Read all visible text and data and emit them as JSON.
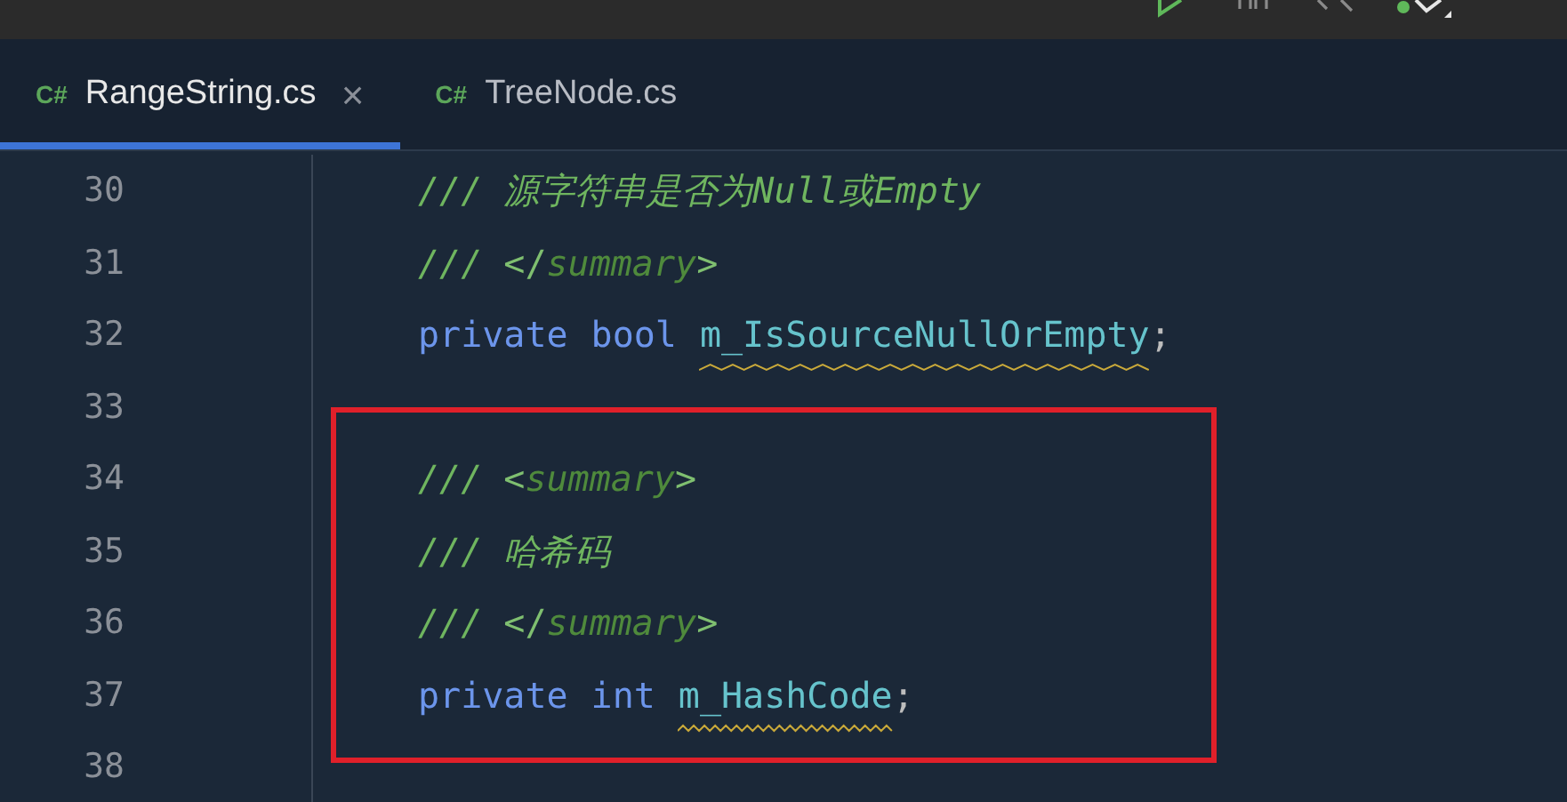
{
  "tabs": [
    {
      "badge": "C#",
      "label": "RangeString.cs",
      "close": "×",
      "selected": true
    },
    {
      "badge": "C#",
      "label": "TreeNode.cs",
      "selected": false
    }
  ],
  "code": {
    "line_numbers": [
      "30",
      "31",
      "32",
      "33",
      "34",
      "35",
      "36",
      "37",
      "38"
    ],
    "blocks": [
      {
        "kind": "plain",
        "lines": [
          {
            "tokens": [
              {
                "text": "/// 源字符串是否为Null或Empty",
                "kind": "comment"
              }
            ]
          },
          {
            "tokens": [
              {
                "text": "/// ",
                "kind": "comment"
              },
              {
                "text": "</",
                "kind": "tag-bracket"
              },
              {
                "text": "summary",
                "kind": "tag-name"
              },
              {
                "text": ">",
                "kind": "tag-bracket"
              }
            ]
          },
          {
            "tokens": [
              {
                "text": "private",
                "kind": "keyword"
              },
              {
                "text": "bool",
                "kind": "keyword"
              },
              {
                "text": "m_IsSourceNullOrEmpty",
                "kind": "field",
                "squiggle": true
              },
              {
                "text": ";",
                "kind": "punct"
              }
            ]
          }
        ]
      },
      {
        "kind": "blank"
      },
      {
        "kind": "highlight",
        "lines": [
          {
            "tokens": [
              {
                "text": "/// ",
                "kind": "comment"
              },
              {
                "text": "<",
                "kind": "tag-bracket"
              },
              {
                "text": "summary",
                "kind": "tag-name"
              },
              {
                "text": ">",
                "kind": "tag-bracket"
              }
            ]
          },
          {
            "tokens": [
              {
                "text": "/// 哈希码",
                "kind": "comment"
              }
            ]
          },
          {
            "tokens": [
              {
                "text": "/// ",
                "kind": "comment"
              },
              {
                "text": "</",
                "kind": "tag-bracket"
              },
              {
                "text": "summary",
                "kind": "tag-name"
              },
              {
                "text": ">",
                "kind": "tag-bracket"
              }
            ]
          },
          {
            "tokens": [
              {
                "text": "private",
                "kind": "keyword"
              },
              {
                "text": "int",
                "kind": "keyword"
              },
              {
                "text": "m_HashCode",
                "kind": "field",
                "squiggle": true
              },
              {
                "text": ";",
                "kind": "punct"
              }
            ]
          }
        ]
      }
    ]
  }
}
